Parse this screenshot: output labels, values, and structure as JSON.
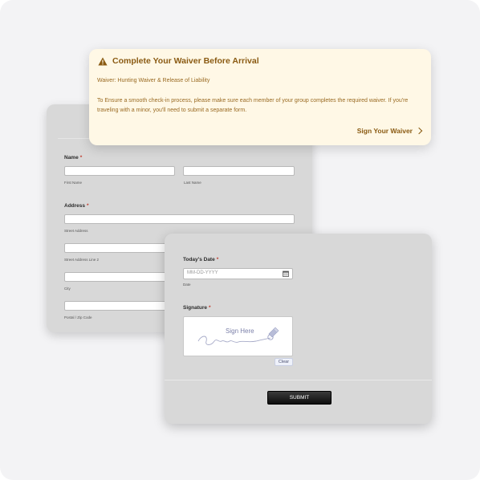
{
  "banner": {
    "title": "Complete Your Waiver Before Arrival",
    "subtitle": "Waiver: Hunting Waiver & Release of Liability",
    "body": "To Ensure a smooth check-in process, please make sure each member of your group completes the required waiver. If you're traveling with a minor, you'll need to submit a separate form.",
    "link_label": "Sign Your Waiver",
    "warning_icon": "warning-triangle-icon",
    "accent_color": "#8a5a12",
    "background_color": "#fff8e6"
  },
  "form": {
    "name_label": "Name",
    "required_mark": "*",
    "first_name_sub": "First Name",
    "last_name_sub": "Last Name",
    "address_label": "Address",
    "street_sub": "Street Address",
    "street2_sub": "Street Address Line 2",
    "city_sub": "City",
    "postal_sub": "Postal / Zip Code"
  },
  "sign_form": {
    "date_label": "Today's Date",
    "date_placeholder": "MM-DD-YYYY",
    "date_sub": "Date",
    "calendar_icon": "calendar-icon",
    "signature_label": "Signature",
    "signature_placeholder": "Sign Here",
    "clear_label": "Clear",
    "submit_label": "SUBMIT"
  }
}
